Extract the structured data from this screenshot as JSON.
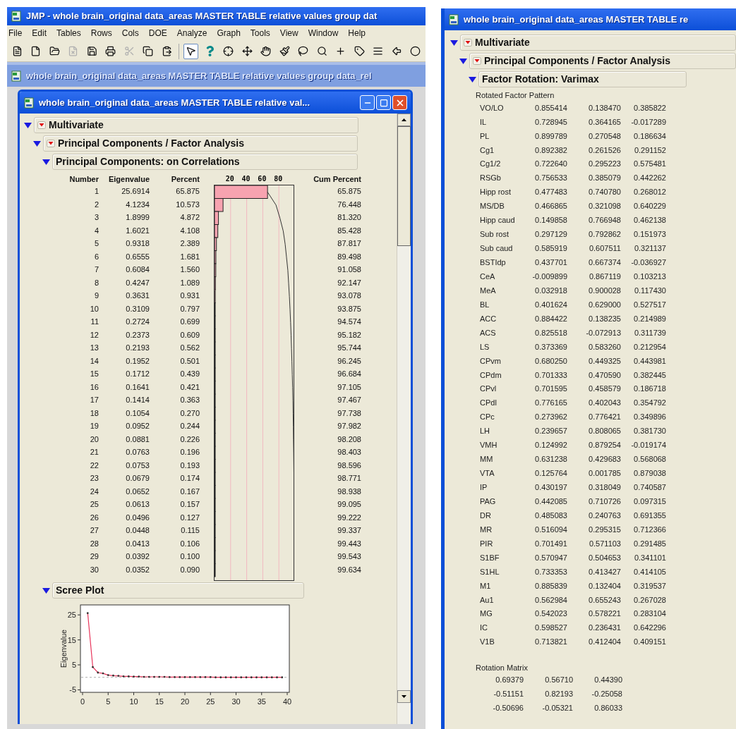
{
  "main_window": {
    "title": "JMP - whole brain_original data_areas MASTER TABLE relative values group dat",
    "menu": [
      "File",
      "Edit",
      "Tables",
      "Rows",
      "Cols",
      "DOE",
      "Analyze",
      "Graph",
      "Tools",
      "View",
      "Window",
      "Help"
    ],
    "toolbar": [
      {
        "selected": false,
        "disabled": false
      },
      {
        "selected": false,
        "disabled": false
      },
      {
        "selected": false,
        "disabled": false
      },
      {
        "selected": false,
        "disabled": true
      },
      {
        "selected": false,
        "disabled": false
      },
      {
        "selected": false,
        "disabled": false
      },
      {
        "selected": false,
        "disabled": true
      },
      {
        "selected": false,
        "disabled": false
      },
      {
        "selected": false,
        "disabled": false
      },
      {
        "selected": true,
        "disabled": false
      },
      {
        "selected": false,
        "disabled": false
      },
      {
        "selected": false,
        "disabled": false
      },
      {
        "selected": false,
        "disabled": false
      },
      {
        "selected": false,
        "disabled": false
      },
      {
        "selected": false,
        "disabled": false
      },
      {
        "selected": false,
        "disabled": false
      },
      {
        "selected": false,
        "disabled": false
      },
      {
        "selected": false,
        "disabled": false
      },
      {
        "selected": false,
        "disabled": false
      },
      {
        "selected": false,
        "disabled": false
      },
      {
        "selected": false,
        "disabled": false
      },
      {
        "selected": false,
        "disabled": false
      }
    ]
  },
  "data_table_window": {
    "title": "whole brain_original data_areas MASTER TABLE relative values group data_rel"
  },
  "report_window": {
    "title": "whole brain_original data_areas MASTER TABLE relative val...",
    "multivariate": {
      "title": "Multivariate",
      "expanded": true,
      "pca": {
        "title": "Principal Components / Factor Analysis",
        "expanded": true,
        "correlations": {
          "title": "Principal Components: on Correlations",
          "expanded": true,
          "columns": [
            "Number",
            "Eigenvalue",
            "Percent",
            "Cum Percent"
          ],
          "rows": [
            {
              "number": "1",
              "eigenvalue": "25.6914",
              "percent": "65.875",
              "cum_percent": "65.875"
            },
            {
              "number": "2",
              "eigenvalue": "4.1234",
              "percent": "10.573",
              "cum_percent": "76.448"
            },
            {
              "number": "3",
              "eigenvalue": "1.8999",
              "percent": "4.872",
              "cum_percent": "81.320"
            },
            {
              "number": "4",
              "eigenvalue": "1.6021",
              "percent": "4.108",
              "cum_percent": "85.428"
            },
            {
              "number": "5",
              "eigenvalue": "0.9318",
              "percent": "2.389",
              "cum_percent": "87.817"
            },
            {
              "number": "6",
              "eigenvalue": "0.6555",
              "percent": "1.681",
              "cum_percent": "89.498"
            },
            {
              "number": "7",
              "eigenvalue": "0.6084",
              "percent": "1.560",
              "cum_percent": "91.058"
            },
            {
              "number": "8",
              "eigenvalue": "0.4247",
              "percent": "1.089",
              "cum_percent": "92.147"
            },
            {
              "number": "9",
              "eigenvalue": "0.3631",
              "percent": "0.931",
              "cum_percent": "93.078"
            },
            {
              "number": "10",
              "eigenvalue": "0.3109",
              "percent": "0.797",
              "cum_percent": "93.875"
            },
            {
              "number": "11",
              "eigenvalue": "0.2724",
              "percent": "0.699",
              "cum_percent": "94.574"
            },
            {
              "number": "12",
              "eigenvalue": "0.2373",
              "percent": "0.609",
              "cum_percent": "95.182"
            },
            {
              "number": "13",
              "eigenvalue": "0.2193",
              "percent": "0.562",
              "cum_percent": "95.744"
            },
            {
              "number": "14",
              "eigenvalue": "0.1952",
              "percent": "0.501",
              "cum_percent": "96.245"
            },
            {
              "number": "15",
              "eigenvalue": "0.1712",
              "percent": "0.439",
              "cum_percent": "96.684"
            },
            {
              "number": "16",
              "eigenvalue": "0.1641",
              "percent": "0.421",
              "cum_percent": "97.105"
            },
            {
              "number": "17",
              "eigenvalue": "0.1414",
              "percent": "0.363",
              "cum_percent": "97.467"
            },
            {
              "number": "18",
              "eigenvalue": "0.1054",
              "percent": "0.270",
              "cum_percent": "97.738"
            },
            {
              "number": "19",
              "eigenvalue": "0.0952",
              "percent": "0.244",
              "cum_percent": "97.982"
            },
            {
              "number": "20",
              "eigenvalue": "0.0881",
              "percent": "0.226",
              "cum_percent": "98.208"
            },
            {
              "number": "21",
              "eigenvalue": "0.0763",
              "percent": "0.196",
              "cum_percent": "98.403"
            },
            {
              "number": "22",
              "eigenvalue": "0.0753",
              "percent": "0.193",
              "cum_percent": "98.596"
            },
            {
              "number": "23",
              "eigenvalue": "0.0679",
              "percent": "0.174",
              "cum_percent": "98.771"
            },
            {
              "number": "24",
              "eigenvalue": "0.0652",
              "percent": "0.167",
              "cum_percent": "98.938"
            },
            {
              "number": "25",
              "eigenvalue": "0.0613",
              "percent": "0.157",
              "cum_percent": "99.095"
            },
            {
              "number": "26",
              "eigenvalue": "0.0496",
              "percent": "0.127",
              "cum_percent": "99.222"
            },
            {
              "number": "27",
              "eigenvalue": "0.0448",
              "percent": "0.115",
              "cum_percent": "99.337"
            },
            {
              "number": "28",
              "eigenvalue": "0.0413",
              "percent": "0.106",
              "cum_percent": "99.443"
            },
            {
              "number": "29",
              "eigenvalue": "0.0392",
              "percent": "0.100",
              "cum_percent": "99.543"
            },
            {
              "number": "30",
              "eigenvalue": "0.0352",
              "percent": "0.090",
              "cum_percent": "99.634"
            }
          ],
          "chart_data": {
            "type": "bar",
            "orientation": "horizontal",
            "grid": true,
            "series": [
              {
                "type": "bar",
                "values": [
                  65.9,
                  10.6,
                  4.9,
                  4.1,
                  2.4,
                  1.7,
                  1.6,
                  1.1,
                  0.9,
                  0.8,
                  0.7,
                  0.6,
                  0.6,
                  0.5,
                  0.4,
                  0.4,
                  0.4,
                  0.3,
                  0.2,
                  0.2,
                  0.2,
                  0.2,
                  0.2,
                  0.2,
                  0.2,
                  0.1,
                  0.1,
                  0.1,
                  0.1,
                  0.1
                ]
              },
              {
                "type": "line",
                "values": [
                  65.9,
                  76.4,
                  81.3,
                  85.4,
                  87.8,
                  89.5,
                  91.1,
                  92.1,
                  93.1,
                  93.9,
                  94.6,
                  95.2,
                  95.7,
                  96.2,
                  96.7,
                  97.1,
                  97.5,
                  97.7,
                  98.0,
                  98.2,
                  98.4,
                  98.6,
                  98.8,
                  98.9,
                  99.1,
                  99.2,
                  99.3,
                  99.4,
                  99.5,
                  99.6
                ]
              }
            ],
            "xlim": [
              0,
              100
            ],
            "xticks": [
              20,
              40,
              60,
              80
            ]
          }
        },
        "scree": {
          "title": "Scree Plot",
          "expanded": true,
          "chart_data": {
            "type": "line",
            "ylabel": "Eigenvalue",
            "x": [
              1,
              2,
              3,
              4,
              5,
              6,
              7,
              8,
              9,
              10,
              11,
              12,
              13,
              14,
              15,
              16,
              17,
              18,
              19,
              20,
              21,
              22,
              23,
              24,
              25,
              26,
              27,
              28,
              29,
              30,
              31,
              32,
              33,
              34,
              35,
              36,
              37,
              38,
              39
            ],
            "values": [
              25.7,
              4.1,
              1.9,
              1.6,
              0.9,
              0.7,
              0.6,
              0.4,
              0.4,
              0.3,
              0.3,
              0.2,
              0.2,
              0.2,
              0.2,
              0.2,
              0.1,
              0.1,
              0.1,
              0.1,
              0.1,
              0.1,
              0.1,
              0.1,
              0.1,
              0,
              0,
              0,
              0,
              0,
              0,
              0,
              0,
              0,
              0,
              0,
              0,
              0,
              0
            ],
            "ref_lines": [
              {
                "axis": "y",
                "value": 0
              }
            ],
            "xlim": [
              0,
              40
            ],
            "ylim": [
              -6,
              29
            ],
            "xticks": [
              0,
              5,
              10,
              15,
              20,
              25,
              30,
              35,
              40
            ],
            "yticks": [
              -5,
              5,
              15,
              25
            ]
          }
        }
      }
    }
  },
  "factor_window": {
    "title": "whole brain_original data_areas MASTER TABLE re",
    "multivariate": {
      "title": "Multivariate",
      "expanded": true,
      "pca": {
        "title": "Principal Components / Factor Analysis",
        "expanded": true,
        "rotation": {
          "title": "Factor Rotation: Varimax",
          "expanded": true,
          "pattern_label": "Rotated Factor Pattern",
          "pattern_rows": [
            {
              "name": "VO/LO",
              "f1": "0.855414",
              "f2": "0.138470",
              "f3": "0.385822"
            },
            {
              "name": "IL",
              "f1": "0.728945",
              "f2": "0.364165",
              "f3": "-0.017289"
            },
            {
              "name": "PL",
              "f1": "0.899789",
              "f2": "0.270548",
              "f3": "0.186634"
            },
            {
              "name": "Cg1",
              "f1": "0.892382",
              "f2": "0.261526",
              "f3": "0.291152"
            },
            {
              "name": "Cg1/2",
              "f1": "0.722640",
              "f2": "0.295223",
              "f3": "0.575481"
            },
            {
              "name": "RSGb",
              "f1": "0.756533",
              "f2": "0.385079",
              "f3": "0.442262"
            },
            {
              "name": "Hipp rost",
              "f1": "0.477483",
              "f2": "0.740780",
              "f3": "0.268012"
            },
            {
              "name": "MS/DB",
              "f1": "0.466865",
              "f2": "0.321098",
              "f3": "0.640229"
            },
            {
              "name": "Hipp caud",
              "f1": "0.149858",
              "f2": "0.766948",
              "f3": "0.462138"
            },
            {
              "name": "Sub rost",
              "f1": "0.297129",
              "f2": "0.792862",
              "f3": "0.151973"
            },
            {
              "name": "Sub caud",
              "f1": "0.585919",
              "f2": "0.607511",
              "f3": "0.321137"
            },
            {
              "name": "BSTIdp",
              "f1": "0.437701",
              "f2": "0.667374",
              "f3": "-0.036927"
            },
            {
              "name": "CeA",
              "f1": "-0.009899",
              "f2": "0.867119",
              "f3": "0.103213"
            },
            {
              "name": "MeA",
              "f1": "0.032918",
              "f2": "0.900028",
              "f3": "0.117430"
            },
            {
              "name": "BL",
              "f1": "0.401624",
              "f2": "0.629000",
              "f3": "0.527517"
            },
            {
              "name": "ACC",
              "f1": "0.884422",
              "f2": "0.138235",
              "f3": "0.214989"
            },
            {
              "name": "ACS",
              "f1": "0.825518",
              "f2": "-0.072913",
              "f3": "0.311739"
            },
            {
              "name": "LS",
              "f1": "0.373369",
              "f2": "0.583260",
              "f3": "0.212954"
            },
            {
              "name": "CPvm",
              "f1": "0.680250",
              "f2": "0.449325",
              "f3": "0.443981"
            },
            {
              "name": "CPdm",
              "f1": "0.701333",
              "f2": "0.470590",
              "f3": "0.382445"
            },
            {
              "name": "CPvl",
              "f1": "0.701595",
              "f2": "0.458579",
              "f3": "0.186718"
            },
            {
              "name": "CPdl",
              "f1": "0.776165",
              "f2": "0.402043",
              "f3": "0.354792"
            },
            {
              "name": "CPc",
              "f1": "0.273962",
              "f2": "0.776421",
              "f3": "0.349896"
            },
            {
              "name": "LH",
              "f1": "0.239657",
              "f2": "0.808065",
              "f3": "0.381730"
            },
            {
              "name": "VMH",
              "f1": "0.124992",
              "f2": "0.879254",
              "f3": "-0.019174"
            },
            {
              "name": "MM",
              "f1": "0.631238",
              "f2": "0.429683",
              "f3": "0.568068"
            },
            {
              "name": "VTA",
              "f1": "0.125764",
              "f2": "0.001785",
              "f3": "0.879038"
            },
            {
              "name": "IP",
              "f1": "0.430197",
              "f2": "0.318049",
              "f3": "0.740587"
            },
            {
              "name": "PAG",
              "f1": "0.442085",
              "f2": "0.710726",
              "f3": "0.097315"
            },
            {
              "name": "DR",
              "f1": "0.485083",
              "f2": "0.240763",
              "f3": "0.691355"
            },
            {
              "name": "MR",
              "f1": "0.516094",
              "f2": "0.295315",
              "f3": "0.712366"
            },
            {
              "name": "PIR",
              "f1": "0.701491",
              "f2": "0.571103",
              "f3": "0.291485"
            },
            {
              "name": "S1BF",
              "f1": "0.570947",
              "f2": "0.504653",
              "f3": "0.341101"
            },
            {
              "name": "S1HL",
              "f1": "0.733353",
              "f2": "0.413427",
              "f3": "0.414105"
            },
            {
              "name": "M1",
              "f1": "0.885839",
              "f2": "0.132404",
              "f3": "0.319537"
            },
            {
              "name": "Au1",
              "f1": "0.562984",
              "f2": "0.655243",
              "f3": "0.267028"
            },
            {
              "name": "MG",
              "f1": "0.542023",
              "f2": "0.578221",
              "f3": "0.283104"
            },
            {
              "name": "IC",
              "f1": "0.598527",
              "f2": "0.236431",
              "f3": "0.642296"
            },
            {
              "name": "V1B",
              "f1": "0.713821",
              "f2": "0.412404",
              "f3": "0.409151"
            }
          ],
          "matrix_label": "Rotation Matrix",
          "matrix_rows": [
            [
              "0.69379",
              "0.56710",
              "0.44390"
            ],
            [
              "-0.51151",
              "0.82193",
              "-0.25058"
            ],
            [
              "-0.50696",
              "-0.05321",
              "0.86033"
            ]
          ]
        }
      }
    }
  }
}
